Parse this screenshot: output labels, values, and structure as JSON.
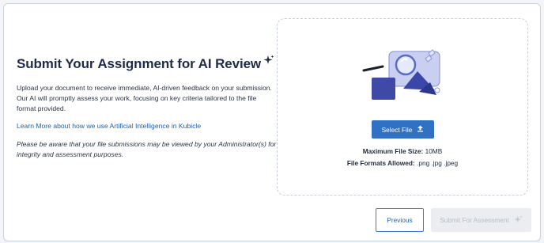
{
  "heading": {
    "title": "Submit Your Assignment for AI Review"
  },
  "description": "Upload your document to receive immediate, AI-driven feedback on your submission. Our AI will promptly assess your work, focusing on key criteria tailored to the file format provided.",
  "learn_more_link": "Learn More about how we use Artificial Intelligence in Kubicle",
  "privacy_note": "Please be aware that your file submissions may be viewed by your Administrator(s) for integrity and assessment purposes.",
  "upload": {
    "select_label": "Select File",
    "max_size_label": "Maximum File Size:",
    "max_size_value": "10MB",
    "formats_label": "File Formats Allowed:",
    "formats_value": ".png .jpg .jpeg"
  },
  "footer": {
    "previous_label": "Previous",
    "submit_label": "Submit For Assessment",
    "submit_enabled": false
  },
  "colors": {
    "primary": "#3071c4",
    "heading": "#1f2b4a",
    "link": "#1f5fad",
    "disabled_bg": "#ebedf0",
    "disabled_text": "#b8bec7"
  },
  "icons": [
    "sparkle-icon",
    "upload-icon",
    "upload-illustration"
  ]
}
